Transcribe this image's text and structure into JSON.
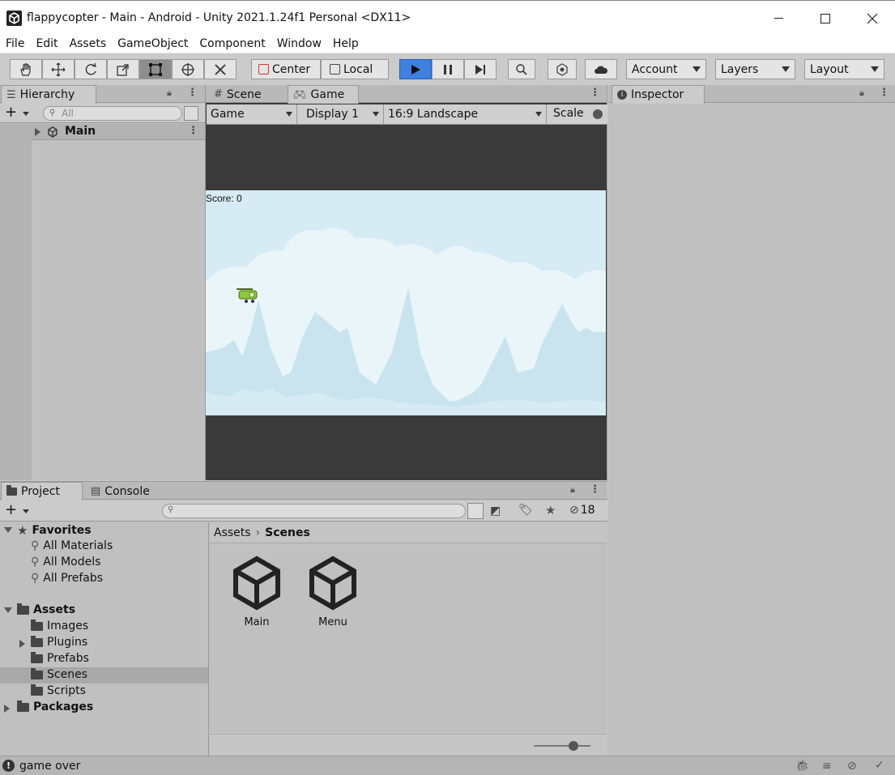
{
  "window": {
    "title": "flappycopter - Main - Android - Unity 2021.1.24f1 Personal <DX11>"
  },
  "menu": [
    "File",
    "Edit",
    "Assets",
    "GameObject",
    "Component",
    "Window",
    "Help"
  ],
  "toolbar": {
    "pivot_label": "Center",
    "space_label": "Local",
    "account_label": "Account",
    "layers_label": "Layers",
    "layout_label": "Layout",
    "play_color": "#3f80e0"
  },
  "hierarchy": {
    "tab": "Hierarchy",
    "search_placeholder": "All",
    "scene_item": "Main"
  },
  "center_tabs": {
    "scene": "Scene",
    "game": "Game"
  },
  "game_bar": {
    "mode": "Game",
    "display": "Display 1",
    "aspect": "16:9 Landscape",
    "scale_label": "Scale"
  },
  "game_view": {
    "score_text": "Score: 0",
    "sky_color": "#d6ebf3",
    "cloud_color": "#eaf5fa",
    "mountain_color": "#c9e4ee"
  },
  "inspector": {
    "tab": "Inspector"
  },
  "project": {
    "tabs": {
      "project": "Project",
      "console": "Console"
    },
    "hidden_count": "18",
    "favorites_label": "Favorites",
    "favorites": [
      "All Materials",
      "All Models",
      "All Prefabs"
    ],
    "assets_label": "Assets",
    "asset_folders": [
      "Images",
      "Plugins",
      "Prefabs",
      "Scenes",
      "Scripts"
    ],
    "packages_label": "Packages",
    "breadcrumb": {
      "root": "Assets",
      "current": "Scenes"
    },
    "files": [
      "Main",
      "Menu"
    ],
    "zoom_level": 0.7
  },
  "status": {
    "message": "game over"
  }
}
